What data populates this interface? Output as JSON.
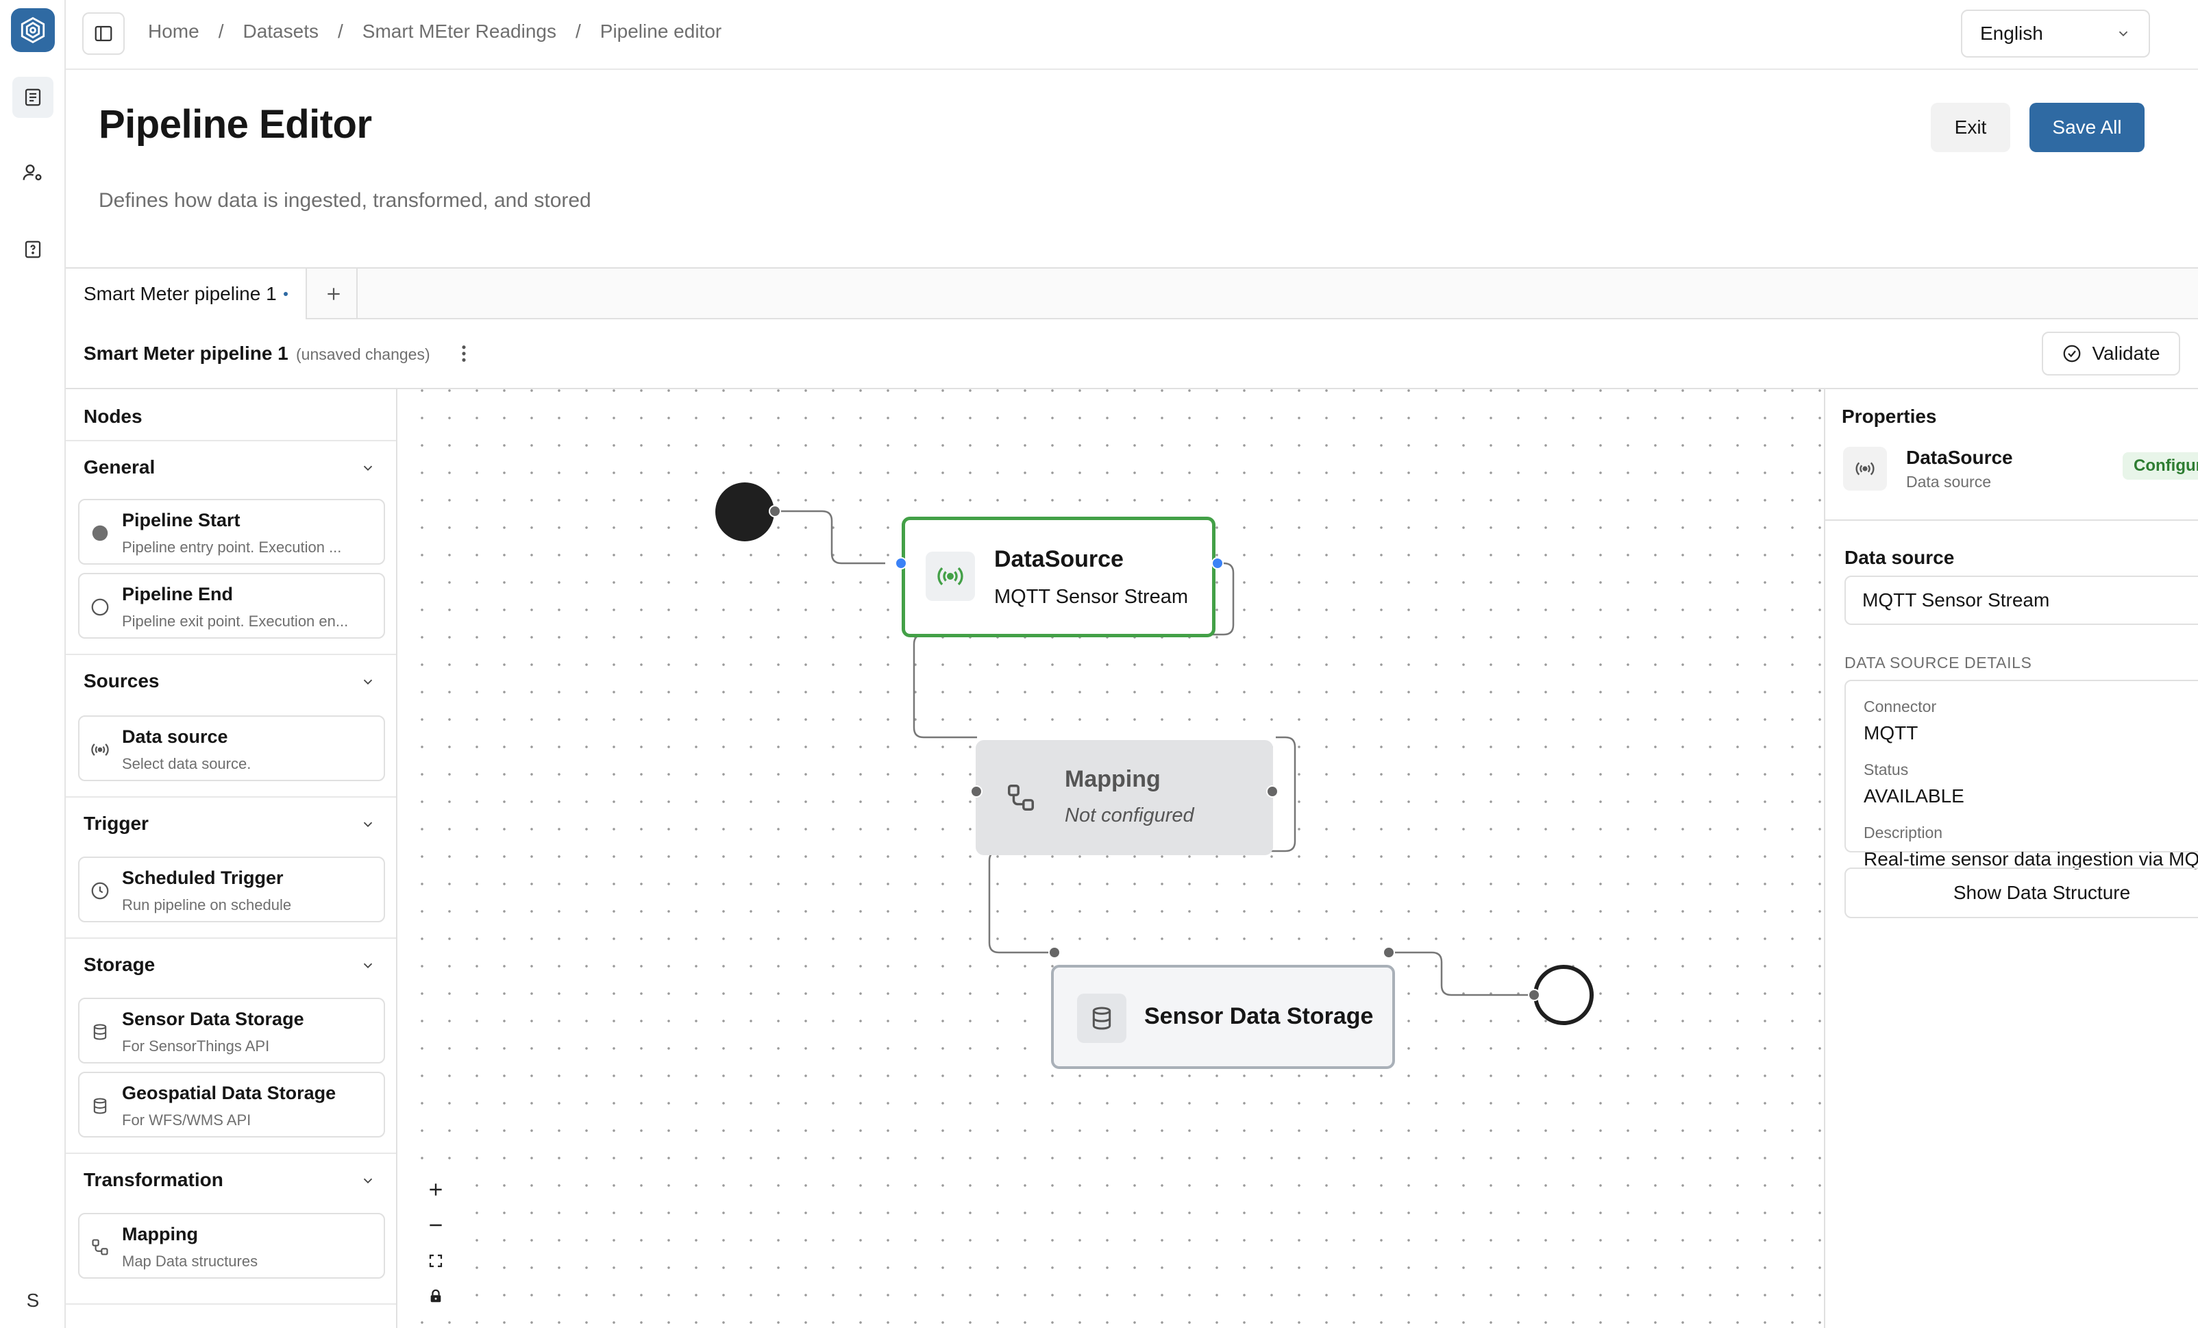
{
  "rail": {
    "avatar_initial": "S"
  },
  "breadcrumb": [
    "Home",
    "Datasets",
    "Smart MEter Readings",
    "Pipeline editor"
  ],
  "language": {
    "selected": "English"
  },
  "header": {
    "title": "Pipeline Editor",
    "subtitle": "Defines how data is ingested, transformed, and stored",
    "exit_label": "Exit",
    "save_label": "Save All"
  },
  "tabs": [
    {
      "label": "Smart Meter pipeline 1"
    }
  ],
  "pipeline": {
    "name": "Smart Meter pipeline 1",
    "status_note": "(unsaved changes)",
    "validate_label": "Validate"
  },
  "palette": {
    "title": "Nodes",
    "sections": {
      "general": {
        "title": "General",
        "items": [
          {
            "title": "Pipeline Start",
            "desc": "Pipeline entry point. Execution ..."
          },
          {
            "title": "Pipeline End",
            "desc": "Pipeline exit point. Execution en..."
          }
        ]
      },
      "sources": {
        "title": "Sources",
        "items": [
          {
            "title": "Data source",
            "desc": "Select data source."
          }
        ]
      },
      "trigger": {
        "title": "Trigger",
        "items": [
          {
            "title": "Scheduled Trigger",
            "desc": "Run pipeline on schedule"
          }
        ]
      },
      "storage": {
        "title": "Storage",
        "items": [
          {
            "title": "Sensor Data Storage",
            "desc": "For SensorThings API"
          },
          {
            "title": "Geospatial Data Storage",
            "desc": "For WFS/WMS API"
          }
        ]
      },
      "transformation": {
        "title": "Transformation",
        "items": [
          {
            "title": "Mapping",
            "desc": "Map Data structures"
          }
        ]
      }
    }
  },
  "canvas": {
    "nodes": {
      "datasource": {
        "title": "DataSource",
        "subtitle": "MQTT Sensor Stream"
      },
      "mapping": {
        "title": "Mapping",
        "subtitle": "Not configured"
      },
      "storage": {
        "title": "Sensor Data Storage"
      }
    }
  },
  "properties": {
    "title": "Properties",
    "node_name": "DataSource",
    "node_type": "Data source",
    "badge": "Configured",
    "data_source_label": "Data source",
    "data_source_value": "MQTT Sensor Stream",
    "details_label": "DATA SOURCE DETAILS",
    "details": {
      "connector_key": "Connector",
      "connector_value": "MQTT",
      "status_key": "Status",
      "status_value": "AVAILABLE",
      "description_key": "Description",
      "description_value": "Real-time sensor data ingestion via MQTT"
    },
    "show_structure_label": "Show Data Structure"
  },
  "colors": {
    "brand": "#2f6aa3",
    "configured": "#43a047",
    "handle_active": "#3b82f6"
  }
}
